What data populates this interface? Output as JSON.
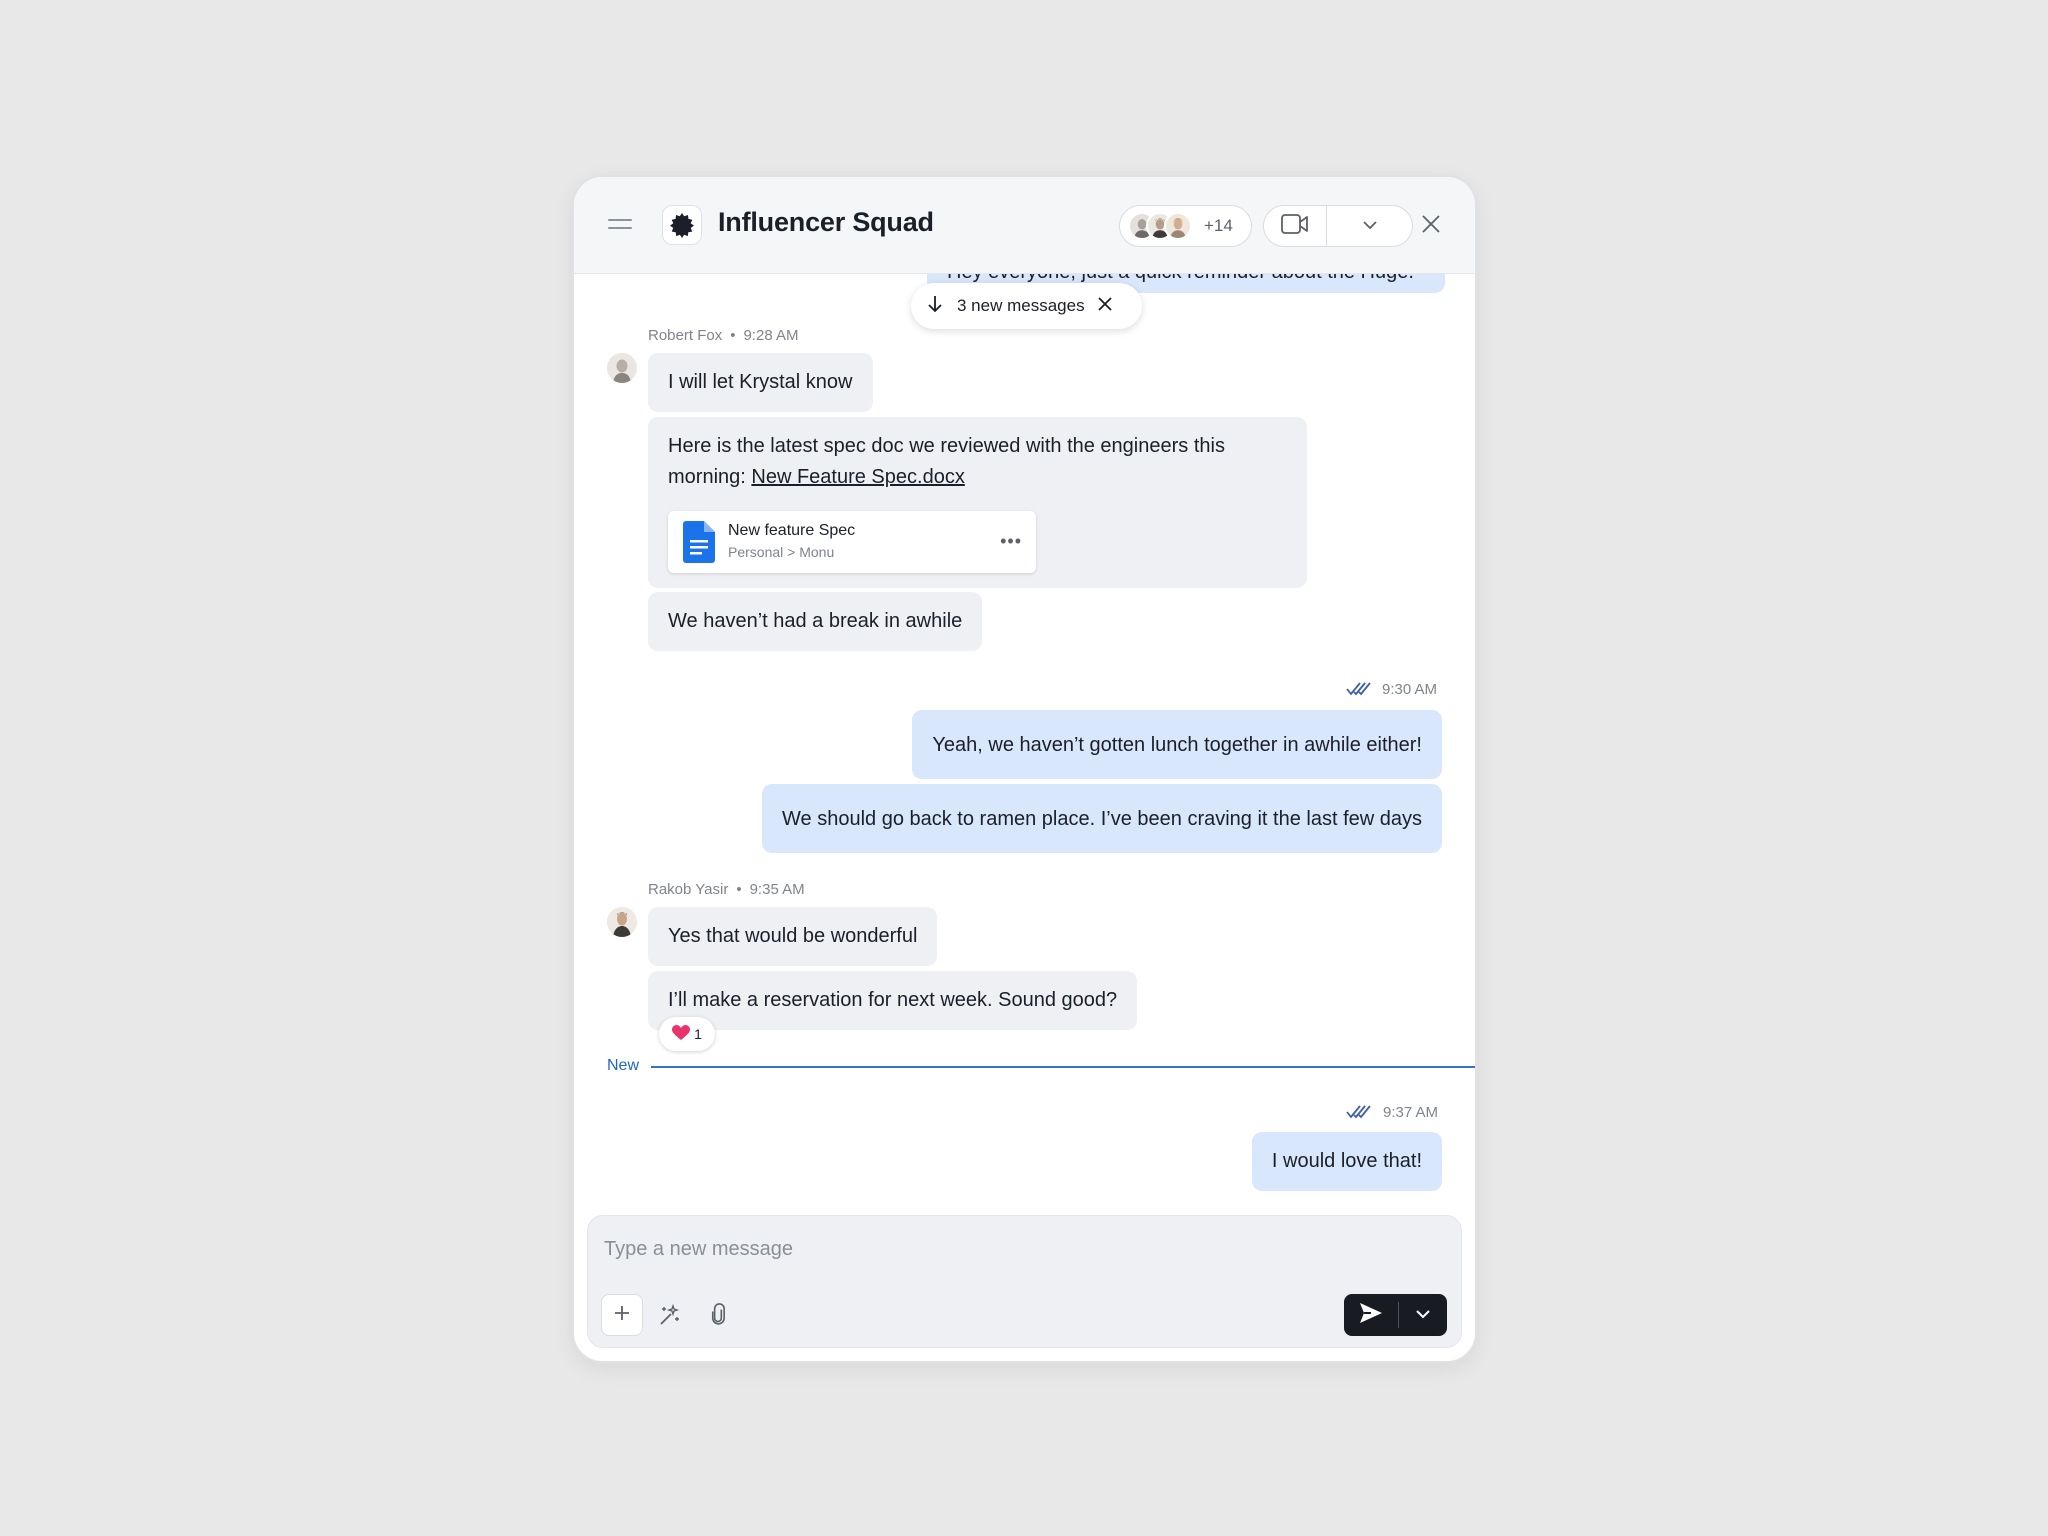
{
  "header": {
    "title": "Influencer Squad",
    "participants_extra": "+14"
  },
  "new_messages_pill": "3 new messages",
  "partial_message": "Hey everyone, just a quick reminder about the Huge.",
  "messages": {
    "robert": {
      "sender": "Robert Fox",
      "time": "9:28 AM",
      "msg1": "I will let Krystal know",
      "msg2_text": "Here is the latest spec doc we reviewed with the engineers this morning: ",
      "msg2_link": "New Feature Spec.docx",
      "file_name": "New feature Spec",
      "file_path": "Personal > Monu",
      "msg3": "We haven’t had a break in awhile"
    },
    "me1": {
      "time": "9:30 AM",
      "msg1": "Yeah, we haven’t gotten lunch together in awhile either!",
      "msg2": "We should go back to ramen place. I’ve been craving it the last few days"
    },
    "rakob": {
      "sender": "Rakob Yasir",
      "time": "9:35 AM",
      "msg1": "Yes that would be wonderful",
      "msg2": "I’ll make a reservation for next week. Sound good?",
      "reaction_count": "1"
    },
    "new_divider": "New",
    "me2": {
      "time": "9:37 AM",
      "msg1": "I would love that!"
    }
  },
  "composer": {
    "placeholder": "Type a new message"
  },
  "icons": {
    "menu": "menu-icon",
    "group_logo": "badge-icon",
    "video": "video-call-icon",
    "close": "close-icon",
    "arrow_down": "arrow-down-icon",
    "read_receipt": "double-check-icon",
    "document": "google-doc-icon",
    "heart": "heart-icon",
    "plus": "plus-icon",
    "ai": "magic-wand-icon",
    "attach": "paperclip-icon",
    "send": "send-icon",
    "chevron": "chevron-down-icon"
  },
  "colors": {
    "outgoing_bubble": "#d9e7fc",
    "incoming_bubble": "#eff0f3",
    "new_divider": "#3a6fc1",
    "send_button": "#181b22",
    "doc_icon": "#1a73e8",
    "heart": "#e8336d"
  }
}
